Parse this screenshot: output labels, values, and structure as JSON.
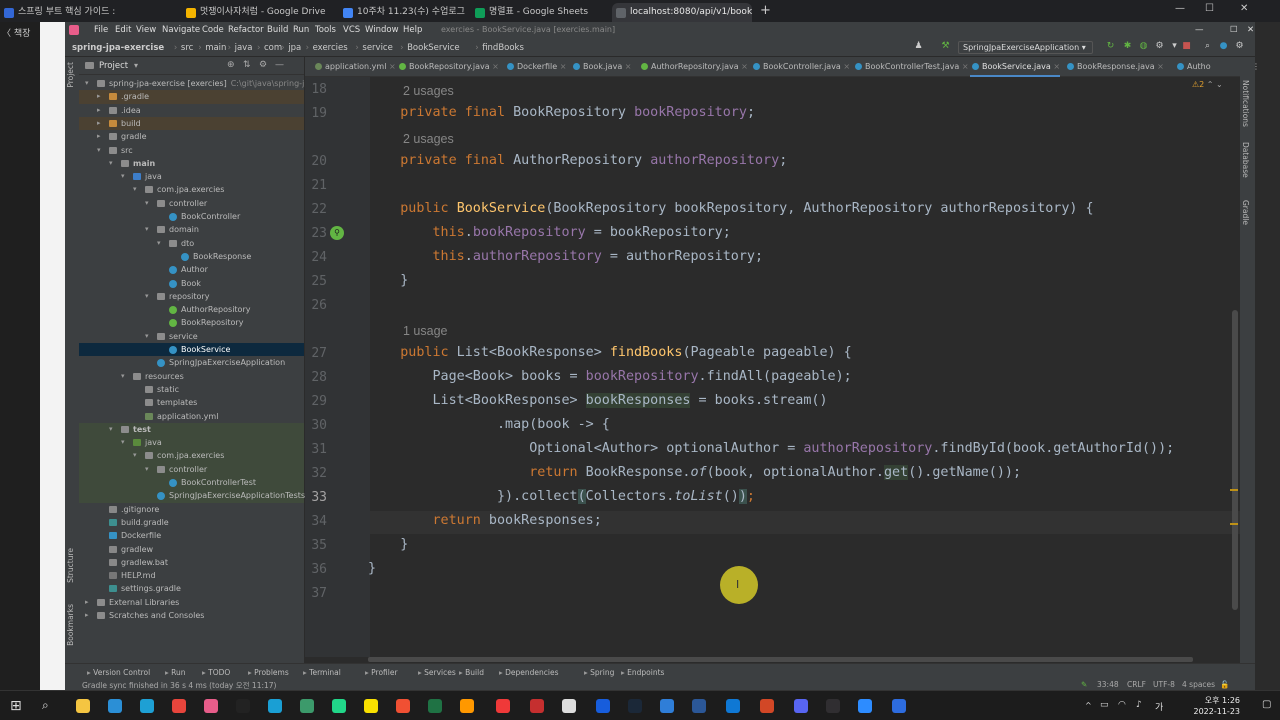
{
  "browser": {
    "tabs": [
      {
        "title": "스프링 부트 핵심 가이드 : 스",
        "color": "#3367d6"
      },
      {
        "title": "멋쟁이사자처럼 - Google Drive",
        "color": "#f4b400"
      },
      {
        "title": "10주차 11.23(수) 수업로그 - Sp",
        "color": "#4285f4"
      },
      {
        "title": "명렬표 - Google Sheets",
        "color": "#0f9d58"
      },
      {
        "title": "localhost:8080/api/v1/books",
        "color": "#5f6368"
      }
    ],
    "new_tab": "+",
    "bookmark_label": "책장"
  },
  "ide": {
    "menu": [
      "File",
      "Edit",
      "View",
      "Navigate",
      "Code",
      "Refactor",
      "Build",
      "Run",
      "Tools",
      "VCS",
      "Window",
      "Help"
    ],
    "window_title": "exercies - BookService.java [exercies.main]",
    "breadcrumbs": [
      "spring-jpa-exercise",
      "src",
      "main",
      "java",
      "com",
      "jpa",
      "exercies",
      "service",
      "BookService",
      "findBooks"
    ],
    "run_config": "SpringJpaExerciseApplication",
    "project_panel_title": "Project",
    "tree": [
      {
        "label": "spring-jpa-exercise [exercies]",
        "extra": "C:\\git\\java\\spring-jpa-",
        "depth": 0,
        "arrow": "v",
        "kind": "module"
      },
      {
        "label": ".gradle",
        "depth": 1,
        "arrow": ">",
        "kind": "folder-orange"
      },
      {
        "label": ".idea",
        "depth": 1,
        "arrow": ">",
        "kind": "folder"
      },
      {
        "label": "build",
        "depth": 1,
        "arrow": ">",
        "kind": "folder-orange"
      },
      {
        "label": "gradle",
        "depth": 1,
        "arrow": ">",
        "kind": "folder"
      },
      {
        "label": "src",
        "depth": 1,
        "arrow": "v",
        "kind": "folder"
      },
      {
        "label": "main",
        "depth": 2,
        "arrow": "v",
        "kind": "folder",
        "bold": true
      },
      {
        "label": "java",
        "depth": 3,
        "arrow": "v",
        "kind": "folder-blue"
      },
      {
        "label": "com.jpa.exercies",
        "depth": 4,
        "arrow": "v",
        "kind": "folder"
      },
      {
        "label": "controller",
        "depth": 5,
        "arrow": "v",
        "kind": "folder"
      },
      {
        "label": "BookController",
        "depth": 6,
        "arrow": "",
        "kind": "class"
      },
      {
        "label": "domain",
        "depth": 5,
        "arrow": "v",
        "kind": "folder"
      },
      {
        "label": "dto",
        "depth": 6,
        "arrow": "v",
        "kind": "folder"
      },
      {
        "label": "BookResponse",
        "depth": 7,
        "arrow": "",
        "kind": "class"
      },
      {
        "label": "Author",
        "depth": 6,
        "arrow": "",
        "kind": "class"
      },
      {
        "label": "Book",
        "depth": 6,
        "arrow": "",
        "kind": "class"
      },
      {
        "label": "repository",
        "depth": 5,
        "arrow": "v",
        "kind": "folder"
      },
      {
        "label": "AuthorRepository",
        "depth": 6,
        "arrow": "",
        "kind": "interface"
      },
      {
        "label": "BookRepository",
        "depth": 6,
        "arrow": "",
        "kind": "interface"
      },
      {
        "label": "service",
        "depth": 5,
        "arrow": "v",
        "kind": "folder"
      },
      {
        "label": "BookService",
        "depth": 6,
        "arrow": "",
        "kind": "class",
        "selected": true
      },
      {
        "label": "SpringJpaExerciseApplication",
        "depth": 5,
        "arrow": "",
        "kind": "class"
      },
      {
        "label": "resources",
        "depth": 3,
        "arrow": "v",
        "kind": "folder"
      },
      {
        "label": "static",
        "depth": 4,
        "arrow": "",
        "kind": "folder"
      },
      {
        "label": "templates",
        "depth": 4,
        "arrow": "",
        "kind": "folder"
      },
      {
        "label": "application.yml",
        "depth": 4,
        "arrow": "",
        "kind": "yml"
      },
      {
        "label": "test",
        "depth": 2,
        "arrow": "v",
        "kind": "folder",
        "bold": true
      },
      {
        "label": "java",
        "depth": 3,
        "arrow": "v",
        "kind": "folder-green"
      },
      {
        "label": "com.jpa.exercies",
        "depth": 4,
        "arrow": "v",
        "kind": "folder"
      },
      {
        "label": "controller",
        "depth": 5,
        "arrow": "v",
        "kind": "folder"
      },
      {
        "label": "BookControllerTest",
        "depth": 6,
        "arrow": "",
        "kind": "class"
      },
      {
        "label": "SpringJpaExerciseApplicationTests",
        "depth": 5,
        "arrow": "",
        "kind": "class"
      },
      {
        "label": ".gitignore",
        "depth": 1,
        "arrow": "",
        "kind": "file"
      },
      {
        "label": "build.gradle",
        "depth": 1,
        "arrow": "",
        "kind": "gradle"
      },
      {
        "label": "Dockerfile",
        "depth": 1,
        "arrow": "",
        "kind": "docker"
      },
      {
        "label": "gradlew",
        "depth": 1,
        "arrow": "",
        "kind": "file"
      },
      {
        "label": "gradlew.bat",
        "depth": 1,
        "arrow": "",
        "kind": "file"
      },
      {
        "label": "HELP.md",
        "depth": 1,
        "arrow": "",
        "kind": "md"
      },
      {
        "label": "settings.gradle",
        "depth": 1,
        "arrow": "",
        "kind": "gradle"
      },
      {
        "label": "External Libraries",
        "depth": 0,
        "arrow": ">",
        "kind": "lib"
      },
      {
        "label": "Scratches and Consoles",
        "depth": 0,
        "arrow": ">",
        "kind": "scratch"
      }
    ],
    "editor_tabs": [
      {
        "label": "application.yml",
        "color": "#6a8759"
      },
      {
        "label": "BookRepository.java",
        "color": "#62b543"
      },
      {
        "label": "Dockerfile",
        "color": "#3592c4"
      },
      {
        "label": "Book.java",
        "color": "#3592c4"
      },
      {
        "label": "AuthorRepository.java",
        "color": "#62b543"
      },
      {
        "label": "BookController.java",
        "color": "#3592c4"
      },
      {
        "label": "BookControllerTest.java",
        "color": "#3592c4"
      },
      {
        "label": "BookService.java",
        "color": "#3592c4",
        "active": true
      },
      {
        "label": "BookResponse.java",
        "color": "#3592c4"
      },
      {
        "label": "Autho",
        "color": "#3592c4"
      }
    ],
    "warning_count": "2",
    "right_panels": [
      "Notifications",
      "Database",
      "Gradle"
    ],
    "left_panels": [
      "Project",
      "Structure",
      "Bookmarks"
    ],
    "code_lines": [
      {
        "n": "18",
        "hint": "2 usages",
        "html": ""
      },
      {
        "n": "19",
        "html": "    <span class='kw'>private final</span> BookRepository <span class='fld'>bookRepository</span>;"
      },
      {
        "n": "",
        "hint": "2 usages",
        "html": ""
      },
      {
        "n": "20",
        "html": "    <span class='kw'>private final</span> AuthorRepository <span class='fld'>authorRepository</span>;"
      },
      {
        "n": "21",
        "html": ""
      },
      {
        "n": "22",
        "html": "    <span class='kw'>public</span> <span class='fn'>BookService</span>(BookRepository bookRepository, AuthorRepository authorRepository) {"
      },
      {
        "n": "23",
        "html": "        <span class='kw'>this</span>.<span class='fld'>bookRepository</span> = bookRepository;"
      },
      {
        "n": "24",
        "html": "        <span class='kw'>this</span>.<span class='fld'>authorRepository</span> = authorRepository;"
      },
      {
        "n": "25",
        "html": "    }"
      },
      {
        "n": "26",
        "html": ""
      },
      {
        "n": "",
        "hint": "1 usage",
        "html": ""
      },
      {
        "n": "27",
        "html": "    <span class='kw'>public</span> List&lt;BookResponse&gt; <span class='fn'>findBooks</span>(Pageable pageable) {"
      },
      {
        "n": "28",
        "html": "        Page&lt;Book&gt; books = <span class='fld'>bookRepository</span>.findAll(pageable);"
      },
      {
        "n": "29",
        "html": "        List&lt;BookResponse&gt; <span class='hl'>bookResponses</span> = books.stream()"
      },
      {
        "n": "30",
        "html": "                .map(book -&gt; {"
      },
      {
        "n": "31",
        "html": "                    Optional&lt;Author&gt; optionalAuthor = <span class='fld'>authorRepository</span>.findById(book.getAuthorId());"
      },
      {
        "n": "32",
        "html": "                    <span class='kw'>return</span> BookResponse.<span class='ital'>of</span>(book, optionalAuthor.<span class='hl'>get</span>().getName());"
      },
      {
        "n": "33",
        "html": "                }).collect<span class='match'>(</span>Collectors.<span class='ital'>toList</span>()<span class='match'>)</span><span class='kw'>;</span>",
        "current": true
      },
      {
        "n": "34",
        "html": "        <span class='kw'>return</span> bookResponses;"
      },
      {
        "n": "35",
        "html": "    }"
      },
      {
        "n": "36",
        "html": "}"
      },
      {
        "n": "37",
        "html": ""
      }
    ],
    "bottom_tools": [
      "Version Control",
      "Run",
      "TODO",
      "Problems",
      "Terminal",
      "Profiler",
      "Services",
      "Build",
      "Dependencies",
      "Spring",
      "Endpoints"
    ],
    "status_left": "Gradle sync finished in 36 s 4 ms (today 오전 11:17)",
    "status_right": [
      "33:48",
      "CRLF",
      "UTF-8",
      "4 spaces"
    ]
  },
  "taskbar": {
    "time": "오후 1:26",
    "date": "2022-11-23",
    "lang": "가"
  }
}
